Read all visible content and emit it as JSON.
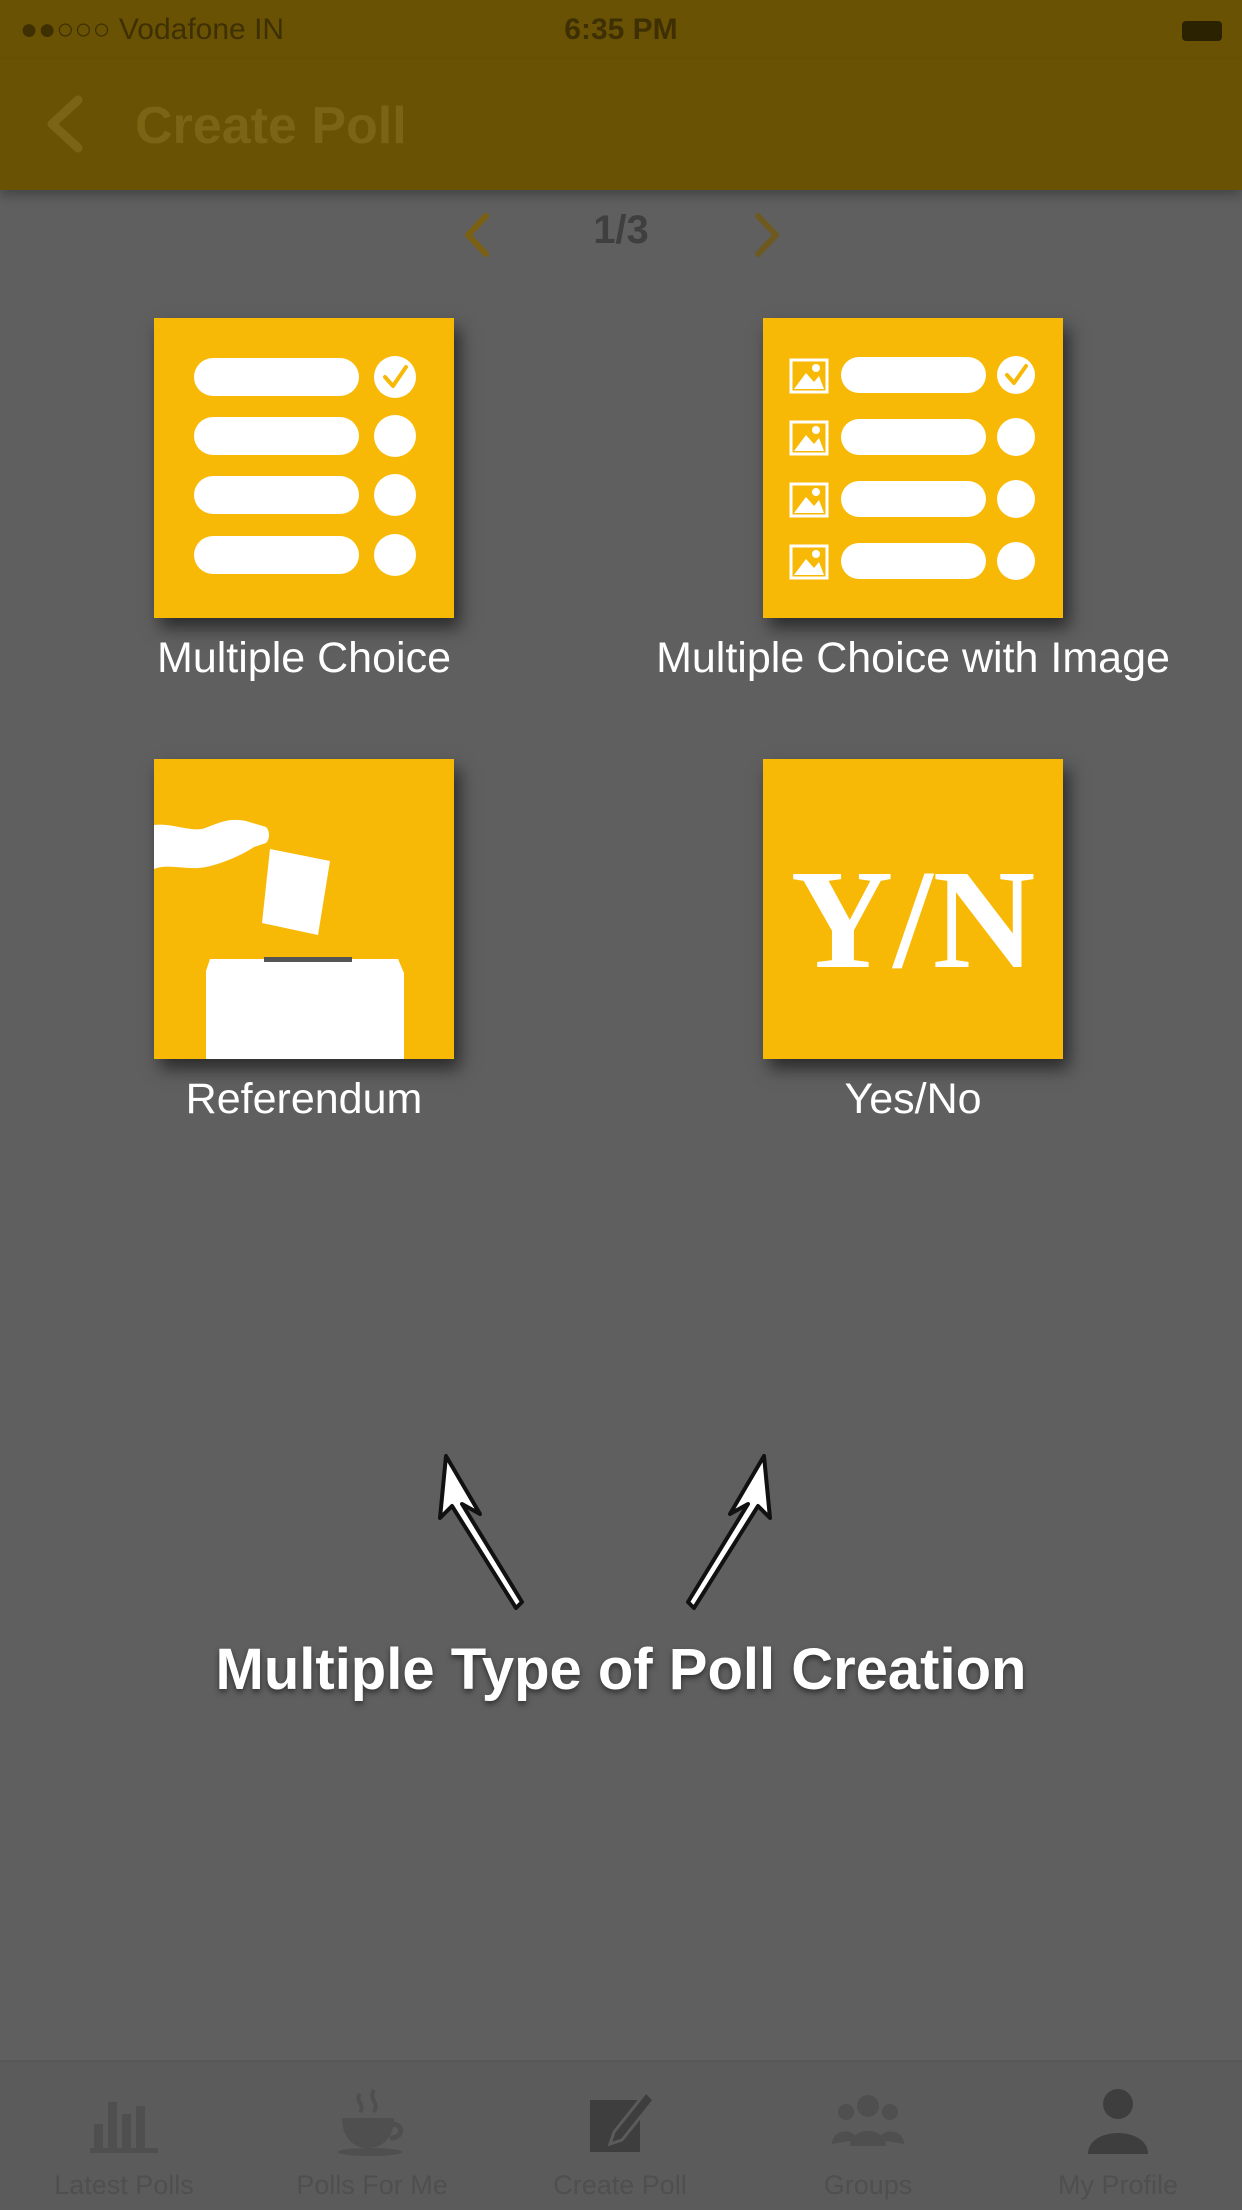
{
  "status_bar": {
    "carrier": "●●○○○ Vodafone IN",
    "time": "6:35 PM"
  },
  "header": {
    "title": "Create Poll"
  },
  "pager": {
    "label": "1/3"
  },
  "poll_types": [
    {
      "label": "Multiple Choice",
      "icon": "multiple-choice-list-icon"
    },
    {
      "label": "Multiple Choice with Image",
      "icon": "image-choice-list-icon"
    },
    {
      "label": "Referendum",
      "icon": "ballot-box-icon"
    },
    {
      "label": "Yes/No",
      "icon": "yes-no-icon",
      "icon_text": "Y/N"
    }
  ],
  "annotation": {
    "text": "Multiple Type of Poll Creation"
  },
  "tabs": [
    {
      "label": "Latest Polls",
      "icon": "bar-chart-icon"
    },
    {
      "label": "Polls For Me",
      "icon": "coffee-cup-icon"
    },
    {
      "label": "Create Poll",
      "icon": "edit-icon"
    },
    {
      "label": "Groups",
      "icon": "groups-icon"
    },
    {
      "label": "My Profile",
      "icon": "user-icon"
    }
  ],
  "colors": {
    "accent": "#f8b906",
    "overlay_background": "#5f5f5f"
  }
}
